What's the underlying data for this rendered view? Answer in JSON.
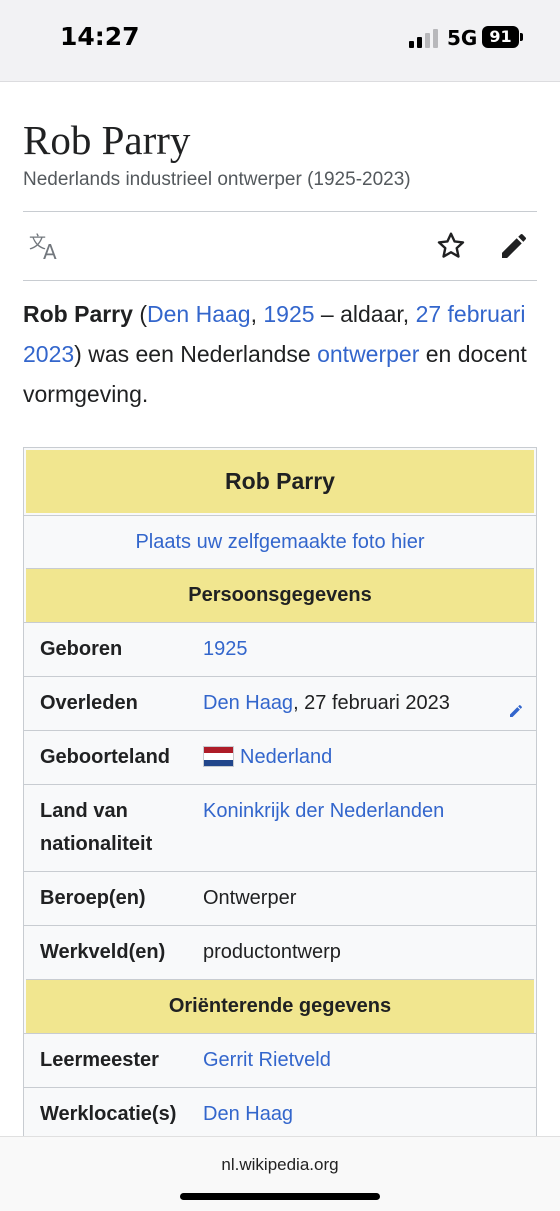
{
  "status": {
    "time": "14:27",
    "network": "5G",
    "battery": "91"
  },
  "article": {
    "title": "Rob Parry",
    "subtitle": "Nederlands industrieel ontwerper (1925-2023)",
    "lead": {
      "name": "Rob Parry",
      "open": " (",
      "birthplace": "Den Haag",
      "comma": ", ",
      "birthyear": "1925",
      "dash": " – aldaar, ",
      "deathdate": "27 februari 2023",
      "mid": ") was een Nederlandse ",
      "profession": "ontwerper",
      "end": " en docent vormgeving."
    }
  },
  "infobox": {
    "title": "Rob Parry",
    "photo_link": "Plaats uw zelfgemaakte foto hier",
    "section_personal": "Persoonsgegevens",
    "rows": [
      {
        "label": "Geboren",
        "value": "1925"
      },
      {
        "label": "Overleden",
        "value_link": "Den Haag",
        "value_text": ", 27 februari 2023"
      },
      {
        "label": "Geboorteland",
        "value": "Nederland"
      },
      {
        "label": "Land van nationaliteit",
        "value": "Koninkrijk der Nederlanden"
      },
      {
        "label": "Beroep(en)",
        "value": "Ontwerper"
      },
      {
        "label": "Werkveld(en)",
        "value": "productontwerp"
      }
    ],
    "section_orient": "Oriënterende gegevens",
    "rows2": [
      {
        "label": "Leermeester",
        "value": "Gerrit Rietveld"
      },
      {
        "label": "Werklocatie(s)",
        "value": "Den Haag"
      }
    ]
  },
  "browser": {
    "url": "nl.wikipedia.org"
  },
  "icons": {
    "language": "translate-icon",
    "watch": "star-icon",
    "edit": "pencil-icon"
  },
  "colors": {
    "link": "#3366cc",
    "infobox_header": "#f1e68f",
    "flag": [
      "#ae1c28",
      "#ffffff",
      "#21468b"
    ]
  }
}
